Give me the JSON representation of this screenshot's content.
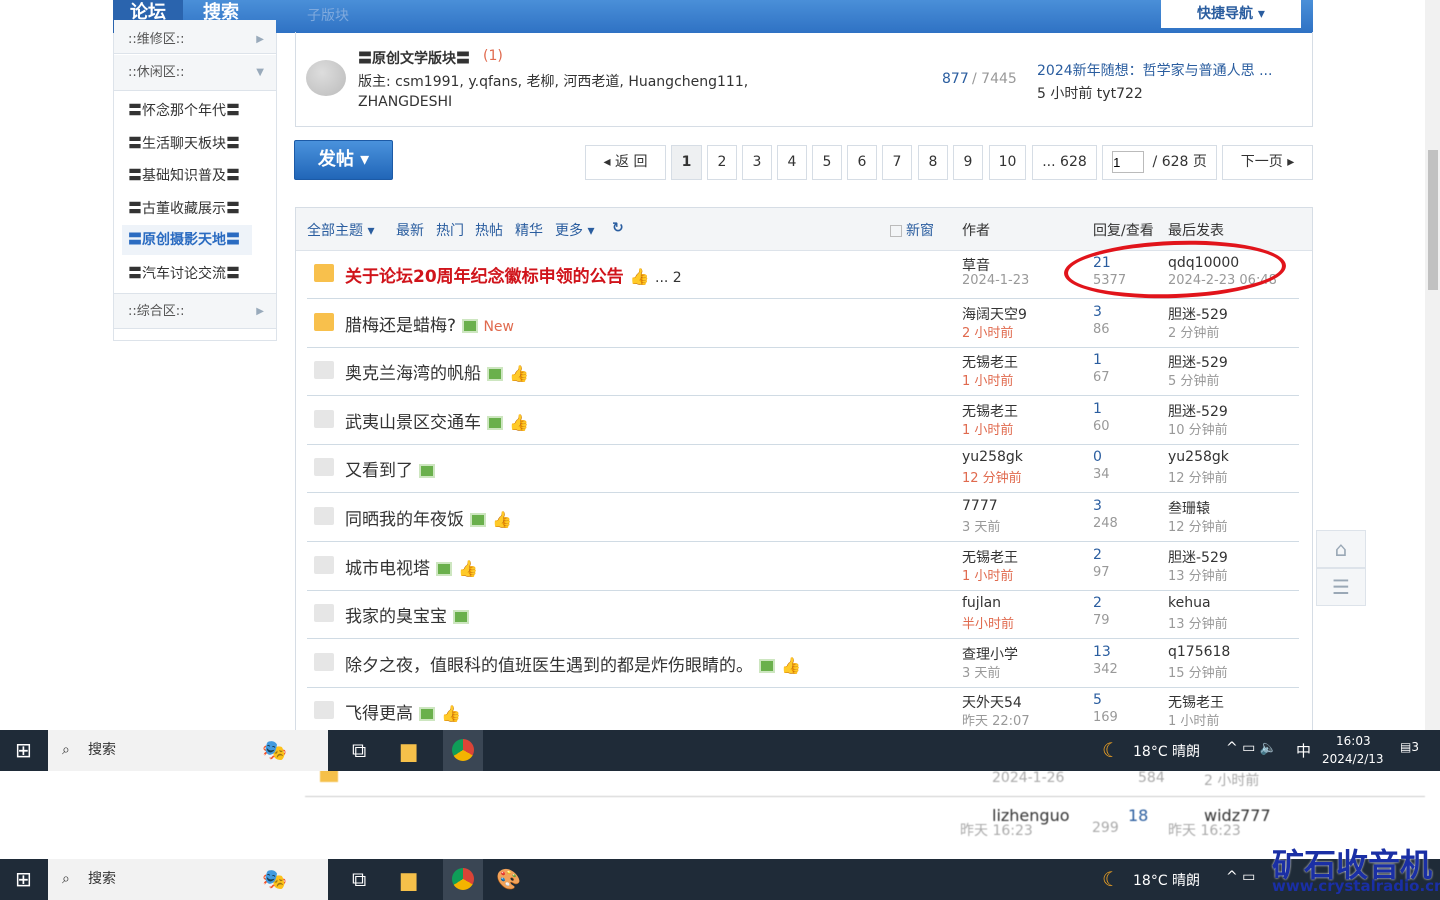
{
  "nav": {
    "tab_forum": "论坛",
    "tab_search": "搜索",
    "subforum_label": "子版块",
    "quick_nav": "快捷导航 ▾"
  },
  "sidebar": {
    "head_repair": "::维修区::",
    "head_leisure": "::休闲区::",
    "head_general": "::综合区::",
    "items": [
      "〓怀念那个年代〓",
      "〓生活聊天板块〓",
      "〓基础知识普及〓",
      "〓古董收藏展示〓",
      "〓原创摄影天地〓",
      "〓汽车讨论交流〓"
    ]
  },
  "subforum": {
    "name": "〓原创文学版块〓",
    "new_count": "(1)",
    "moderators": "版主: csm1991, y.qfans, 老柳, 河西老道, Huangcheng111,",
    "moderators2": "ZHANGDESHI",
    "threads": "877",
    "posts": "/ 7445",
    "last_title": "2024新年随想：哲学家与普通人思 ...",
    "last_info": "5 小时前 tyt722"
  },
  "post_button": "发帖 ▾",
  "pagination": {
    "back": "◂ 返 回",
    "pages": [
      "1",
      "2",
      "3",
      "4",
      "5",
      "6",
      "7",
      "8",
      "9",
      "10",
      "... 628"
    ],
    "input": "1",
    "total": "/ 628 页",
    "next": "下一页 ▸"
  },
  "table_header": {
    "all": "全部主题 ▾",
    "latest": "最新",
    "hot": "热门",
    "hot_posts": "热帖",
    "digest": "精华",
    "more": "更多 ▾",
    "new_window": "新窗",
    "author": "作者",
    "replies_views": "回复/查看",
    "last_post": "最后发表"
  },
  "threads": [
    {
      "title": "关于论坛20周年纪念徽标申领的公告",
      "suffix": "... 2",
      "sticky": true,
      "thumb": true,
      "img": false,
      "author": "草音",
      "time": "2024-1-23",
      "red": false,
      "replies": "21",
      "views": "5377",
      "last_user": "qdq10000",
      "last_time": "2024-2-23 06:48"
    },
    {
      "title": "腊梅还是蜡梅?",
      "new": "New",
      "sticky": false,
      "hot": true,
      "img": true,
      "thumb": false,
      "author": "海阔天空9",
      "time": "2 小时前",
      "red": true,
      "replies": "3",
      "views": "86",
      "last_user": "胆迷-529",
      "last_time": "2 分钟前"
    },
    {
      "title": "奥克兰海湾的帆船",
      "img": true,
      "thumb": true,
      "author": "无锡老王",
      "time": "1 小时前",
      "red": true,
      "replies": "1",
      "views": "67",
      "last_user": "胆迷-529",
      "last_time": "5 分钟前"
    },
    {
      "title": "武夷山景区交通车",
      "img": true,
      "thumb": true,
      "author": "无锡老王",
      "time": "1 小时前",
      "red": true,
      "replies": "1",
      "views": "60",
      "last_user": "胆迷-529",
      "last_time": "10 分钟前"
    },
    {
      "title": "又看到了",
      "img": true,
      "thumb": false,
      "author": "yu258gk",
      "time": "12 分钟前",
      "red": true,
      "replies": "0",
      "views": "34",
      "last_user": "yu258gk",
      "last_time": "12 分钟前"
    },
    {
      "title": "同晒我的年夜饭",
      "img": true,
      "thumb": true,
      "author": "7777",
      "time": "3 天前",
      "red": false,
      "replies": "3",
      "views": "248",
      "last_user": "叁珊辕",
      "last_time": "12 分钟前"
    },
    {
      "title": "城市电视塔",
      "img": true,
      "thumb": true,
      "author": "无锡老王",
      "time": "1 小时前",
      "red": true,
      "replies": "2",
      "views": "97",
      "last_user": "胆迷-529",
      "last_time": "13 分钟前"
    },
    {
      "title": "我家的臭宝宝",
      "img": true,
      "thumb": false,
      "author": "fujlan",
      "time": "半小时前",
      "red": true,
      "replies": "2",
      "views": "79",
      "last_user": "kehua",
      "last_time": "13 分钟前"
    },
    {
      "title": "除夕之夜，值眼科的值班医生遇到的都是炸伤眼睛的。",
      "img": true,
      "thumb": true,
      "author": "查理小学",
      "time": "3 天前",
      "red": false,
      "replies": "13",
      "views": "342",
      "last_user": "q175618",
      "last_time": "15 分钟前"
    },
    {
      "title": "飞得更高",
      "img": true,
      "thumb": true,
      "author": "天外天54",
      "time": "昨天 22:07",
      "red": false,
      "replies": "5",
      "views": "169",
      "last_user": "无锡老王",
      "last_time": "1 小时前"
    }
  ],
  "ghost": {
    "r1_time": "2024-1-26",
    "r1_views": "584",
    "r1_last": "2 小时前",
    "r2_author": "lizhenguo",
    "r2_replies": "18",
    "r2_last": "widz777",
    "r2_time": "昨天 16:23",
    "r2_views": "299",
    "r2_ltime": "昨天 16:23"
  },
  "taskbar": {
    "search": "搜索",
    "weather": "18°C 晴朗",
    "ime": "中",
    "time": "16:03",
    "date": "2024/2/13",
    "notif": "3"
  },
  "watermark": {
    "title": "矿石收音机",
    "url": "www.crystalradio.cn"
  },
  "colors": {
    "accent": "#2f72c4",
    "sticky_title": "#d0141b",
    "annotation": "#e1141b"
  }
}
